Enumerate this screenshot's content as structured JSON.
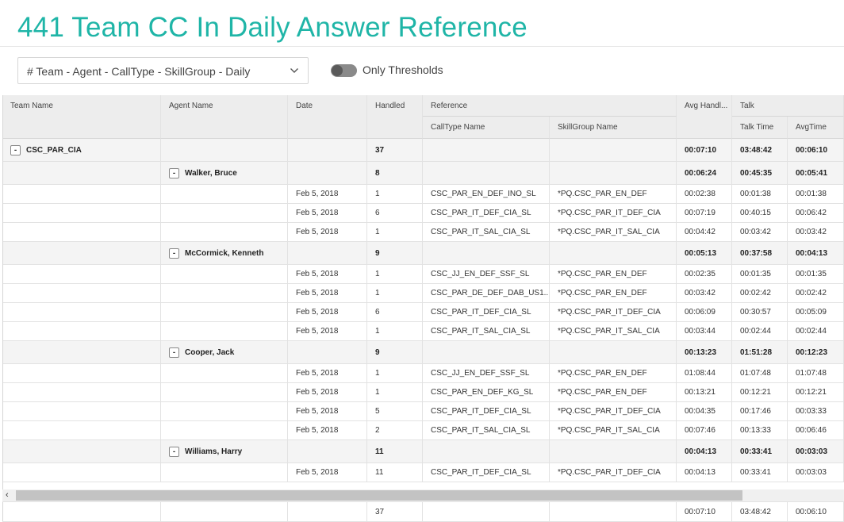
{
  "title": "441 Team CC In Daily Answer Reference",
  "selector": {
    "value": "# Team - Agent - CallType - SkillGroup - Daily"
  },
  "toggle": {
    "label": "Only Thresholds"
  },
  "headers": {
    "team": "Team Name",
    "agent": "Agent Name",
    "date": "Date",
    "handled": "Handled",
    "reference": "Reference",
    "calltype": "CallType Name",
    "skillgroup": "SkillGroup Name",
    "avg_handle": "Avg Handl...",
    "talk": "Talk",
    "talk_time": "Talk Time",
    "avg_time": "AvgTime"
  },
  "rows": [
    {
      "level": 0,
      "team": "CSC_PAR_CIA",
      "agent": "",
      "date": "",
      "handled": "37",
      "calltype": "",
      "skillgroup": "",
      "avg": "00:07:10",
      "talk": "03:48:42",
      "avgtime": "00:06:10"
    },
    {
      "level": 1,
      "team": "",
      "agent": "Walker, Bruce",
      "date": "",
      "handled": "8",
      "calltype": "",
      "skillgroup": "",
      "avg": "00:06:24",
      "talk": "00:45:35",
      "avgtime": "00:05:41"
    },
    {
      "level": 2,
      "team": "",
      "agent": "",
      "date": "Feb 5, 2018",
      "handled": "1",
      "calltype": "CSC_PAR_EN_DEF_INO_SL",
      "skillgroup": "*PQ.CSC_PAR_EN_DEF",
      "avg": "00:02:38",
      "talk": "00:01:38",
      "avgtime": "00:01:38"
    },
    {
      "level": 2,
      "team": "",
      "agent": "",
      "date": "Feb 5, 2018",
      "handled": "6",
      "calltype": "CSC_PAR_IT_DEF_CIA_SL",
      "skillgroup": "*PQ.CSC_PAR_IT_DEF_CIA",
      "avg": "00:07:19",
      "talk": "00:40:15",
      "avgtime": "00:06:42"
    },
    {
      "level": 2,
      "team": "",
      "agent": "",
      "date": "Feb 5, 2018",
      "handled": "1",
      "calltype": "CSC_PAR_IT_SAL_CIA_SL",
      "skillgroup": "*PQ.CSC_PAR_IT_SAL_CIA",
      "avg": "00:04:42",
      "talk": "00:03:42",
      "avgtime": "00:03:42"
    },
    {
      "level": 1,
      "team": "",
      "agent": "McCormick, Kenneth",
      "date": "",
      "handled": "9",
      "calltype": "",
      "skillgroup": "",
      "avg": "00:05:13",
      "talk": "00:37:58",
      "avgtime": "00:04:13"
    },
    {
      "level": 2,
      "team": "",
      "agent": "",
      "date": "Feb 5, 2018",
      "handled": "1",
      "calltype": "CSC_JJ_EN_DEF_SSF_SL",
      "skillgroup": "*PQ.CSC_PAR_EN_DEF",
      "avg": "00:02:35",
      "talk": "00:01:35",
      "avgtime": "00:01:35"
    },
    {
      "level": 2,
      "team": "",
      "agent": "",
      "date": "Feb 5, 2018",
      "handled": "1",
      "calltype": "CSC_PAR_DE_DEF_DAB_US1...",
      "skillgroup": "*PQ.CSC_PAR_EN_DEF",
      "avg": "00:03:42",
      "talk": "00:02:42",
      "avgtime": "00:02:42"
    },
    {
      "level": 2,
      "team": "",
      "agent": "",
      "date": "Feb 5, 2018",
      "handled": "6",
      "calltype": "CSC_PAR_IT_DEF_CIA_SL",
      "skillgroup": "*PQ.CSC_PAR_IT_DEF_CIA",
      "avg": "00:06:09",
      "talk": "00:30:57",
      "avgtime": "00:05:09"
    },
    {
      "level": 2,
      "team": "",
      "agent": "",
      "date": "Feb 5, 2018",
      "handled": "1",
      "calltype": "CSC_PAR_IT_SAL_CIA_SL",
      "skillgroup": "*PQ.CSC_PAR_IT_SAL_CIA",
      "avg": "00:03:44",
      "talk": "00:02:44",
      "avgtime": "00:02:44"
    },
    {
      "level": 1,
      "team": "",
      "agent": "Cooper, Jack",
      "date": "",
      "handled": "9",
      "calltype": "",
      "skillgroup": "",
      "avg": "00:13:23",
      "talk": "01:51:28",
      "avgtime": "00:12:23"
    },
    {
      "level": 2,
      "team": "",
      "agent": "",
      "date": "Feb 5, 2018",
      "handled": "1",
      "calltype": "CSC_JJ_EN_DEF_SSF_SL",
      "skillgroup": "*PQ.CSC_PAR_EN_DEF",
      "avg": "01:08:44",
      "talk": "01:07:48",
      "avgtime": "01:07:48"
    },
    {
      "level": 2,
      "team": "",
      "agent": "",
      "date": "Feb 5, 2018",
      "handled": "1",
      "calltype": "CSC_PAR_EN_DEF_KG_SL",
      "skillgroup": "*PQ.CSC_PAR_EN_DEF",
      "avg": "00:13:21",
      "talk": "00:12:21",
      "avgtime": "00:12:21"
    },
    {
      "level": 2,
      "team": "",
      "agent": "",
      "date": "Feb 5, 2018",
      "handled": "5",
      "calltype": "CSC_PAR_IT_DEF_CIA_SL",
      "skillgroup": "*PQ.CSC_PAR_IT_DEF_CIA",
      "avg": "00:04:35",
      "talk": "00:17:46",
      "avgtime": "00:03:33"
    },
    {
      "level": 2,
      "team": "",
      "agent": "",
      "date": "Feb 5, 2018",
      "handled": "2",
      "calltype": "CSC_PAR_IT_SAL_CIA_SL",
      "skillgroup": "*PQ.CSC_PAR_IT_SAL_CIA",
      "avg": "00:07:46",
      "talk": "00:13:33",
      "avgtime": "00:06:46"
    },
    {
      "level": 1,
      "team": "",
      "agent": "Williams, Harry",
      "date": "",
      "handled": "11",
      "calltype": "",
      "skillgroup": "",
      "avg": "00:04:13",
      "talk": "00:33:41",
      "avgtime": "00:03:03"
    },
    {
      "level": 2,
      "team": "",
      "agent": "",
      "date": "Feb 5, 2018",
      "handled": "11",
      "calltype": "CSC_PAR_IT_DEF_CIA_SL",
      "skillgroup": "*PQ.CSC_PAR_IT_DEF_CIA",
      "avg": "00:04:13",
      "talk": "00:33:41",
      "avgtime": "00:03:03"
    }
  ],
  "totals": {
    "handled": "37",
    "avg": "00:07:10",
    "talk": "03:48:42",
    "avgtime": "00:06:10"
  },
  "icons": {
    "expander": "-",
    "scroll_left": "‹"
  }
}
